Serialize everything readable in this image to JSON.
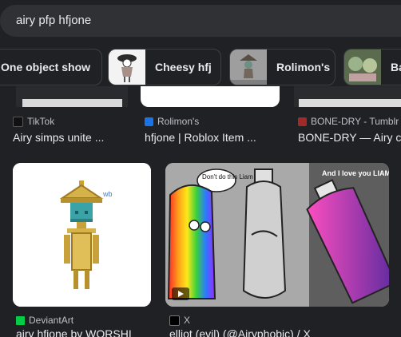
{
  "search": {
    "query": "airy pfp hfjone"
  },
  "chips": [
    {
      "label": "One object show"
    },
    {
      "label": "Cheesy hfj"
    },
    {
      "label": "Rolimon's"
    },
    {
      "label": "Ba"
    }
  ],
  "results_top": [
    {
      "source": "TikTok",
      "title": "Airy simps unite ..."
    },
    {
      "source": "Rolimon's",
      "title": "hfjone | Roblox Item ..."
    },
    {
      "source": "BONE-DRY - Tumblr",
      "title": "BONE-DRY — Airy c"
    }
  ],
  "results_bottom": [
    {
      "source": "DeviantArt",
      "title": "airy hfjone by WORSHI",
      "image_text": "wb"
    },
    {
      "source": "X",
      "title": "elliot (evil) (@Airyphobic) / X",
      "comic_text_left": "Don't do this Liam",
      "comic_text_right": "And I love you LIAM!"
    }
  ],
  "colors": {
    "background": "#202124",
    "surface": "#303134",
    "text": "#e8eaed",
    "muted": "#bdc1c6"
  }
}
